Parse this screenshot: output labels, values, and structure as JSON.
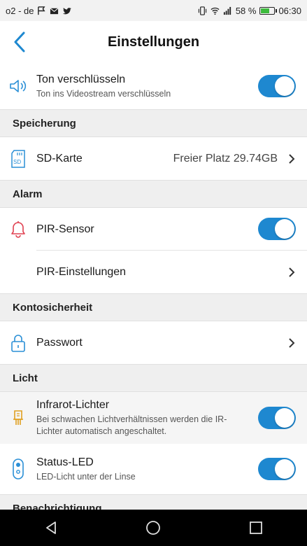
{
  "status_bar": {
    "carrier": "o2 - de",
    "battery": "58 %",
    "battery_level": 0.58,
    "time": "06:30",
    "icons_left": [
      "flag-icon",
      "mail-icon",
      "twitter-icon"
    ],
    "icons_right": [
      "vibrate-icon",
      "wifi-icon",
      "signal-icon",
      "battery-icon"
    ]
  },
  "header": {
    "title": "Einstellungen",
    "back_icon": "back-arrow-icon"
  },
  "colors": {
    "accent": "#1e88d0",
    "alarm_icon": "#e04050",
    "infrared_icon": "#e0a020",
    "section_bg": "#efefef"
  },
  "rows": {
    "audio": {
      "title": "Ton verschlüsseln",
      "sub": "Ton ins Videostream verschlüsseln",
      "toggle": true
    },
    "storage": {
      "section": "Speicherung",
      "title": "SD-Karte",
      "value": "Freier Platz 29.74GB"
    },
    "alarm": {
      "section": "Alarm",
      "pir_title": "PIR-Sensor",
      "pir_toggle": true,
      "pir_settings": "PIR-Einstellungen"
    },
    "account": {
      "section": "Kontosicherheit",
      "title": "Passwort"
    },
    "light": {
      "section": "Licht",
      "ir_title": "Infrarot-Lichter",
      "ir_sub": "Bei schwachen Lichtverhältnissen werden die IR-Lichter automatisch angeschaltet.",
      "ir_toggle": true,
      "led_title": "Status-LED",
      "led_sub": "LED-Licht unter der Linse",
      "led_toggle": true
    },
    "notify": {
      "section": "Benachrichtigung"
    }
  },
  "nav": {
    "back": "nav-back-icon",
    "home": "nav-home-icon",
    "recent": "nav-recent-icon"
  }
}
